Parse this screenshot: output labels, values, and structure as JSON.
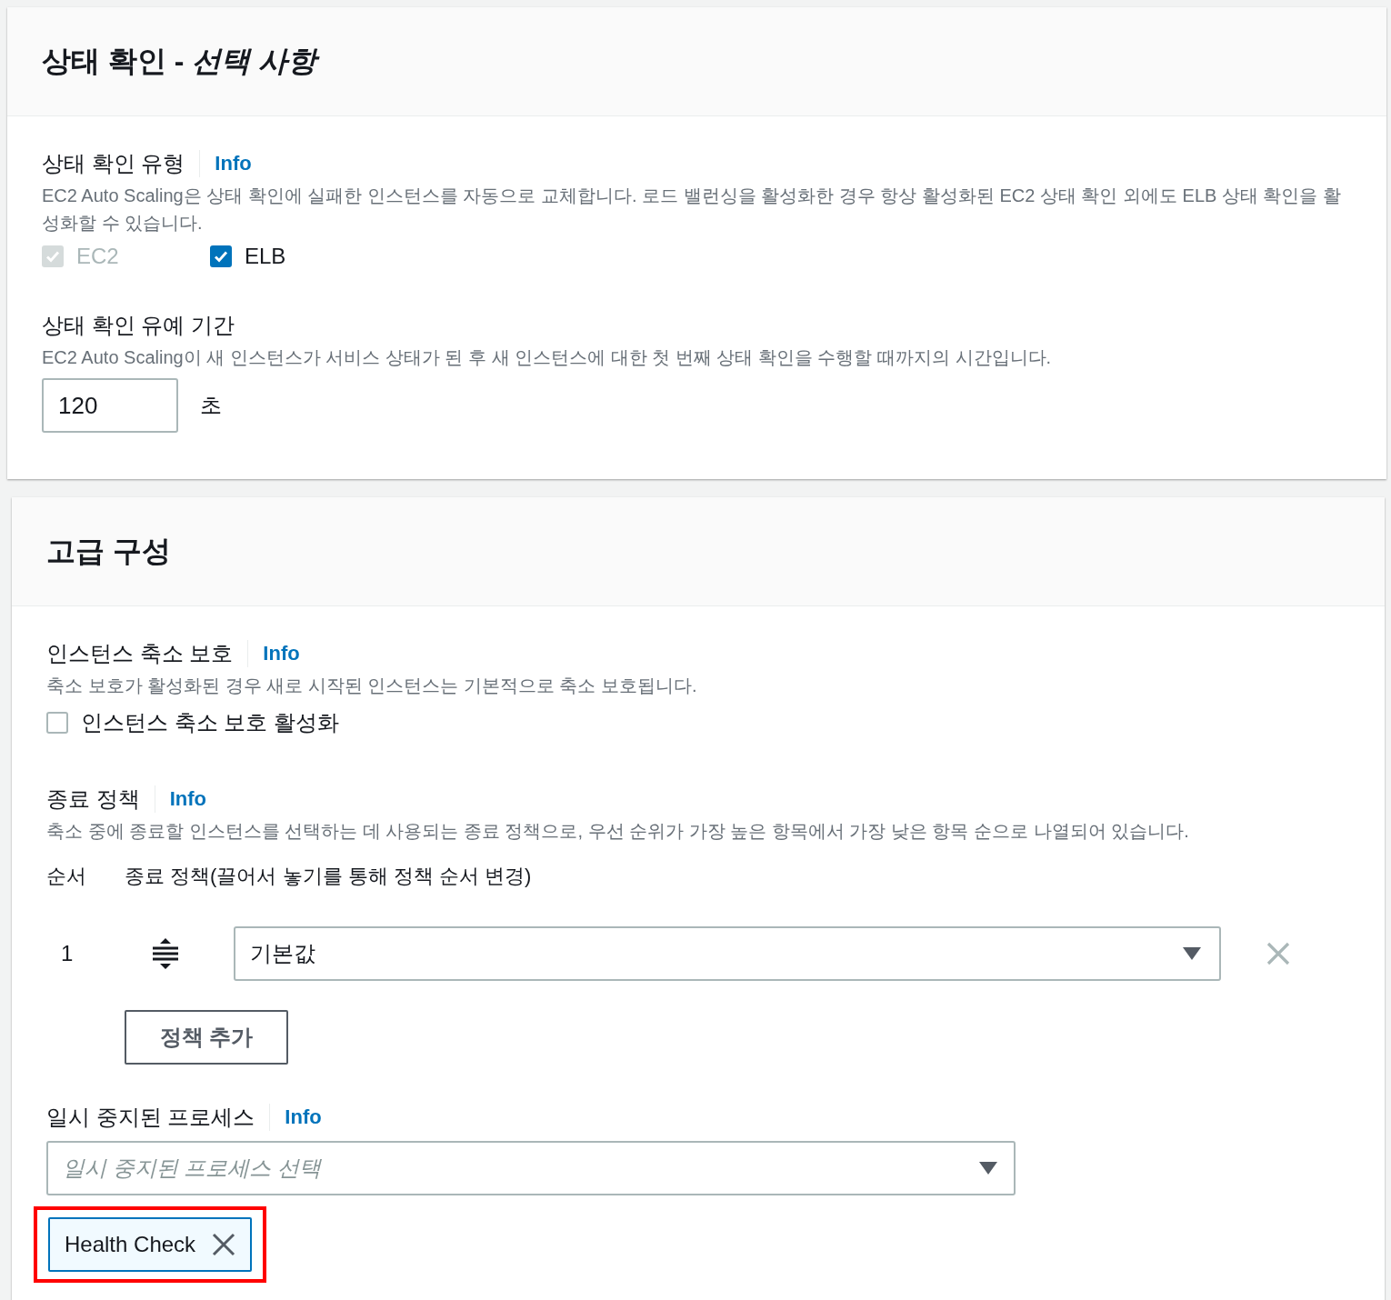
{
  "health_check": {
    "title": "상태 확인 - *선택 사항*",
    "type_field": {
      "label": "상태 확인 유형",
      "info": "Info",
      "description": "EC2 Auto Scaling은 상태 확인에 실패한 인스턴스를 자동으로 교체합니다. 로드 밸런싱을 활성화한 경우 항상 활성화된 EC2 상태 확인 외에도 ELB 상태 확인을 활성화할 수 있습니다.",
      "options": [
        {
          "label": "EC2",
          "checked": true,
          "disabled": true
        },
        {
          "label": "ELB",
          "checked": true,
          "disabled": false
        }
      ]
    },
    "grace_period": {
      "label": "상태 확인 유예 기간",
      "description": "EC2 Auto Scaling이 새 인스턴스가 서비스 상태가 된 후 새 인스턴스에 대한 첫 번째 상태 확인을 수행할 때까지의 시간입니다.",
      "value": "120",
      "unit": "초"
    }
  },
  "advanced": {
    "title": "고급 구성",
    "scale_in_protection": {
      "label": "인스턴스 축소 보호",
      "info": "Info",
      "description": "축소 보호가 활성화된 경우 새로 시작된 인스턴스는 기본적으로 축소 보호됩니다.",
      "checkbox": {
        "label": "인스턴스 축소 보호 활성화",
        "checked": false
      }
    },
    "termination_policies": {
      "label": "종료 정책",
      "info": "Info",
      "description": "축소 중에 종료할 인스턴스를 선택하는 데 사용되는 종료 정책으로, 우선 순위가 가장 높은 항목에서 가장 낮은 항목 순으로 나열되어 있습니다.",
      "columns": [
        "순서",
        "종료 정책(끌어서 놓기를 통해 정책 순서 변경)"
      ],
      "rows": [
        {
          "order": "1",
          "value": "기본값"
        }
      ],
      "add_button": "정책 추가"
    },
    "suspended_processes": {
      "label": "일시 중지된 프로세스",
      "info": "Info",
      "placeholder": "일시 중지된 프로세스 선택",
      "tokens": [
        {
          "label": "Health Check",
          "highlighted": true
        }
      ]
    }
  }
}
